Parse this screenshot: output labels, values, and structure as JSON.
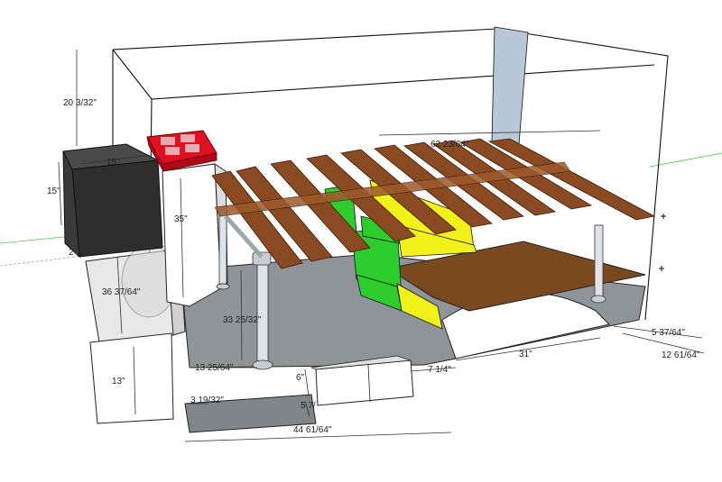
{
  "dimensions": {
    "height_upper": "20 3/32\"",
    "box_width": "15\"",
    "box_height": "15\"",
    "box_side_partial": "2",
    "post_height": "35\"",
    "left_height": "36 37/64\"",
    "step_height": "13\"",
    "post_span": "33 25/32\"",
    "top_length": "62 23/64\"",
    "floor_offset": "13 25/64\"",
    "drawer_height": "6\"",
    "drawer_depth": "5 7/",
    "left_gap": "3 19/32\"",
    "base_length": "44 61/64\"",
    "small_gap": "7 1/4\"",
    "arch_width": "31\"",
    "right_offset": "5 37/64\"",
    "right_depth": "12 61/64\""
  },
  "colors": {
    "wood": "#8a4a22",
    "yellow": "#f2f21a",
    "green": "#2ccc2c",
    "red": "#e01020",
    "floor": "#8f9499",
    "brown_board": "#7a4a1e",
    "box_dark": "#2e2e2e",
    "blue_panel": "#b8c8d8"
  },
  "icons": {
    "stove": "stove-icon",
    "cursor_cross": "crosshair-icon"
  }
}
